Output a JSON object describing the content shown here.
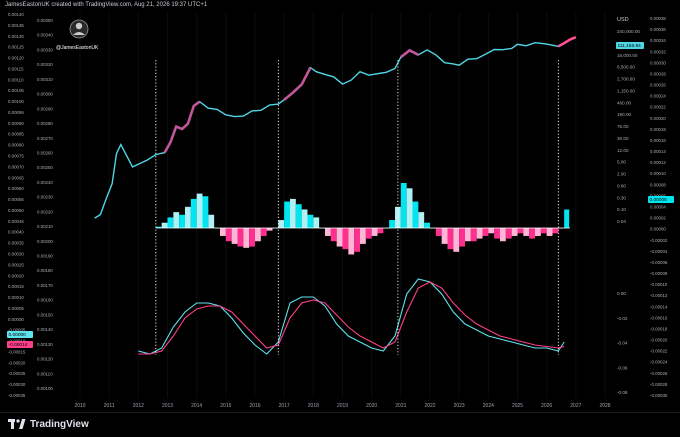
{
  "header": {
    "credit": "JamesEastonUK created with TradingView.com, Aug 21, 2026 19:37 UTC+1",
    "avatar_label": "@JamesEastonUK"
  },
  "footer": {
    "brand": "TradingView"
  },
  "colors": {
    "background": "#000000",
    "price_line": "#4fd6e6",
    "price_highlight": "#c2569a",
    "price_recent": "#ff4f93",
    "hist_positive_dark": "#00e5f0",
    "hist_positive_light": "#aef0f3",
    "hist_negative_dark": "#ff2f8f",
    "hist_negative_light": "#ffb6d6",
    "osc_cyan": "#5fe3ee",
    "osc_magenta": "#ff3f8a",
    "vline": "#ffffff"
  },
  "chart_data": {
    "type": "line",
    "x_axis": {
      "ticks": [
        "2010",
        "2011",
        "2012",
        "2013",
        "2014",
        "2015",
        "2016",
        "2017",
        "2018",
        "2019",
        "2020",
        "2021",
        "2022",
        "2023",
        "2024",
        "2025",
        "2026",
        "2027",
        "2028"
      ]
    },
    "left_axis_outer": {
      "ticks": [
        "0.00140",
        "0.00135",
        "0.00130",
        "0.00125",
        "0.00120",
        "0.00115",
        "0.00110",
        "0.00105",
        "0.00100",
        "0.00095",
        "0.00090",
        "0.00085",
        "0.00080",
        "0.00075",
        "0.00070",
        "0.00065",
        "0.00060",
        "0.00055",
        "0.00050",
        "0.00045",
        "0.00040",
        "0.00035",
        "0.00030",
        "0.00025",
        "0.00020",
        "0.00015",
        "0.00010",
        "0.00005",
        "0.00000",
        "-0.00005",
        "-0.00010",
        "-0.00015",
        "-0.00020",
        "-0.00025",
        "-0.00030",
        "-0.00035"
      ],
      "badge_cyan": "0.00000",
      "badge_magenta": "-0.00014"
    },
    "left_axis_inner": {
      "ticks": [
        "0.00350",
        "0.00340",
        "0.00330",
        "0.00320",
        "0.00310",
        "0.00300",
        "0.00290",
        "0.00280",
        "0.00270",
        "0.00260",
        "0.00250",
        "0.00240",
        "0.00230",
        "0.00220",
        "0.00210",
        "0.00200",
        "0.00190",
        "0.00180",
        "0.00170",
        "0.00160",
        "0.00150",
        "0.00140",
        "0.00130",
        "0.00120",
        "0.00110",
        "0.00100"
      ]
    },
    "right_axis_price": {
      "currency": "USD",
      "ticks": [
        "240,000.00",
        "40,000.00",
        "16,000.00",
        "6,500.00",
        "2,700.00",
        "1,150.00",
        "460.00",
        "190.00",
        "75.00",
        "30.00",
        "12.00",
        "5.00",
        "2.00",
        "0.80",
        "0.30",
        "0.10",
        "0.04"
      ],
      "badge": "111,156.84"
    },
    "right_axis_mid": {
      "ticks": [
        "0.00",
        "-0.02",
        "-0.04",
        "-0.06",
        "-0.08"
      ]
    },
    "right_axis_outer": {
      "ticks": [
        "0.00038",
        "0.00036",
        "0.00034",
        "0.00032",
        "0.00030",
        "0.00028",
        "0.00026",
        "0.00024",
        "0.00022",
        "0.00020",
        "0.00018",
        "0.00016",
        "0.00014",
        "0.00012",
        "0.00010",
        "0.00008",
        "0.00006",
        "0.00004",
        "0.00002",
        "0.00000",
        "-0.00002",
        "-0.00004",
        "-0.00006",
        "-0.00008",
        "-0.00010",
        "-0.00012",
        "-0.00014",
        "-0.00016",
        "-0.00018",
        "-0.00020",
        "-0.00022",
        "-0.00024",
        "-0.00026",
        "-0.00028",
        "-0.00030"
      ],
      "badge": "0.00006"
    },
    "price_series": {
      "x": [
        2010.5,
        2010.7,
        2010.9,
        2011.1,
        2011.25,
        2011.4,
        2011.6,
        2011.8,
        2012.0,
        2012.3,
        2012.6,
        2012.9,
        2013.1,
        2013.3,
        2013.5,
        2013.7,
        2013.9,
        2014.1,
        2014.4,
        2014.7,
        2015.0,
        2015.3,
        2015.6,
        2015.9,
        2016.2,
        2016.5,
        2016.8,
        2017.0,
        2017.3,
        2017.6,
        2017.9,
        2018.1,
        2018.4,
        2018.7,
        2019.0,
        2019.3,
        2019.6,
        2019.9,
        2020.2,
        2020.5,
        2020.8,
        2021.0,
        2021.3,
        2021.6,
        2021.9,
        2022.2,
        2022.5,
        2022.8,
        2023.0,
        2023.3,
        2023.6,
        2023.9,
        2024.2,
        2024.5,
        2024.8,
        2025.0,
        2025.3,
        2025.6,
        2025.9,
        2026.2,
        2026.4,
        2026.6,
        2026.8,
        2027.0
      ],
      "usd": [
        0.06,
        0.08,
        0.3,
        1.0,
        12.0,
        25.0,
        10.0,
        4.0,
        5.0,
        7.0,
        11.0,
        13.0,
        30.0,
        110.0,
        90.0,
        140.0,
        600.0,
        850.0,
        500.0,
        450.0,
        290.0,
        250.0,
        260.0,
        400.0,
        420.0,
        650.0,
        700.0,
        1000.0,
        1800.0,
        3500.0,
        14000.0,
        10000.0,
        8000.0,
        6500.0,
        3600.0,
        5000.0,
        10000.0,
        7500.0,
        8500.0,
        9500.0,
        13000.0,
        33000.0,
        58000.0,
        40000.0,
        60000.0,
        40000.0,
        21000.0,
        19000.0,
        17000.0,
        28000.0,
        29000.0,
        42000.0,
        62000.0,
        61000.0,
        68000.0,
        95000.0,
        84000.0,
        108000.0,
        100000.0,
        88000.0,
        80000.0,
        105000.0,
        140000.0,
        170000.0
      ]
    },
    "histogram": {
      "x": [
        2012.6,
        2012.8,
        2013.0,
        2013.2,
        2013.4,
        2013.6,
        2013.8,
        2014.0,
        2014.2,
        2014.4,
        2014.6,
        2014.8,
        2015.0,
        2015.2,
        2015.4,
        2015.6,
        2015.8,
        2016.0,
        2016.2,
        2016.4,
        2016.6,
        2016.8,
        2017.0,
        2017.2,
        2017.4,
        2017.6,
        2017.8,
        2018.0,
        2018.2,
        2018.4,
        2018.6,
        2018.8,
        2019.0,
        2019.2,
        2019.4,
        2019.6,
        2019.8,
        2020.0,
        2020.2,
        2020.4,
        2020.6,
        2020.8,
        2021.0,
        2021.2,
        2021.4,
        2021.6,
        2021.8,
        2022.0,
        2022.2,
        2022.4,
        2022.6,
        2022.8,
        2023.0,
        2023.2,
        2023.4,
        2023.6,
        2023.8,
        2024.0,
        2024.2,
        2024.4,
        2024.6,
        2024.8,
        2025.0,
        2025.2,
        2025.4,
        2025.6,
        2025.8,
        2026.0,
        2026.2,
        2026.4,
        2026.6
      ],
      "values": [
        1e-05,
        4e-05,
        8e-05,
        0.00012,
        0.0001,
        0.00016,
        0.00022,
        0.00026,
        0.00024,
        0.0001,
        0.0,
        -6e-05,
        -0.0001,
        -0.00012,
        -0.00014,
        -0.00015,
        -0.00014,
        -0.0001,
        -6e-05,
        -2e-05,
        0.0,
        6e-05,
        0.0002,
        0.00022,
        0.00018,
        0.00014,
        0.0001,
        8e-05,
        0.0,
        -6e-05,
        -0.0001,
        -0.00014,
        -0.00016,
        -0.0002,
        -0.00018,
        -0.00012,
        -8e-05,
        -6e-05,
        -4e-05,
        0.0,
        6e-05,
        0.00016,
        0.00034,
        0.0003,
        0.0002,
        0.00012,
        4e-05,
        0.0,
        -6e-05,
        -0.00012,
        -0.00016,
        -0.00018,
        -0.00014,
        -0.0001,
        -0.0001,
        -8e-05,
        -6e-05,
        -4e-05,
        -8e-05,
        -0.0001,
        -8e-05,
        -6e-05,
        -4e-05,
        -6e-05,
        -8e-05,
        -6e-05,
        -4e-05,
        -6e-05,
        -4e-05,
        0.0,
        0.00014
      ]
    },
    "oscillator": {
      "x": [
        2012.0,
        2012.4,
        2012.8,
        2013.2,
        2013.6,
        2014.0,
        2014.4,
        2014.8,
        2015.2,
        2015.6,
        2016.0,
        2016.4,
        2016.8,
        2017.2,
        2017.6,
        2018.0,
        2018.4,
        2018.8,
        2019.2,
        2019.6,
        2020.0,
        2020.4,
        2020.8,
        2021.2,
        2021.6,
        2022.0,
        2022.4,
        2022.8,
        2023.2,
        2023.6,
        2024.0,
        2024.4,
        2024.8,
        2025.2,
        2025.6,
        2026.0,
        2026.4,
        2026.6
      ],
      "series": [
        {
          "values": [
            -0.00022,
            -0.00024,
            -0.0002,
            -6e-05,
            4e-05,
            0.0001,
            0.0001,
            8e-05,
            0.0,
            -0.0001,
            -0.00018,
            -0.00024,
            -0.00016,
            0.0001,
            0.00014,
            0.00014,
            8e-05,
            -4e-05,
            -0.00012,
            -0.00016,
            -0.0002,
            -0.00022,
            -0.00012,
            0.00016,
            0.00026,
            0.00024,
            0.00016,
            4e-05,
            -4e-05,
            -8e-05,
            -0.00012,
            -0.00014,
            -0.00016,
            -0.00018,
            -0.0002,
            -0.0002,
            -0.00022,
            -0.00016
          ]
        },
        {
          "values": [
            -0.00024,
            -0.00024,
            -0.00022,
            -0.00012,
            0.0,
            6e-05,
            8e-05,
            8e-05,
            4e-05,
            -4e-05,
            -0.00012,
            -0.0002,
            -0.00018,
            0.0,
            0.0001,
            0.00012,
            0.0001,
            2e-05,
            -6e-05,
            -0.00012,
            -0.00016,
            -0.0002,
            -0.00016,
            4e-05,
            0.0002,
            0.00024,
            0.0002,
            0.0001,
            2e-05,
            -4e-05,
            -8e-05,
            -0.00012,
            -0.00014,
            -0.00016,
            -0.00018,
            -0.00019,
            -0.0002,
            -0.00019
          ]
        }
      ]
    },
    "cycle_markers_x": [
      2012.6,
      2016.8,
      2020.9,
      2026.4
    ]
  }
}
